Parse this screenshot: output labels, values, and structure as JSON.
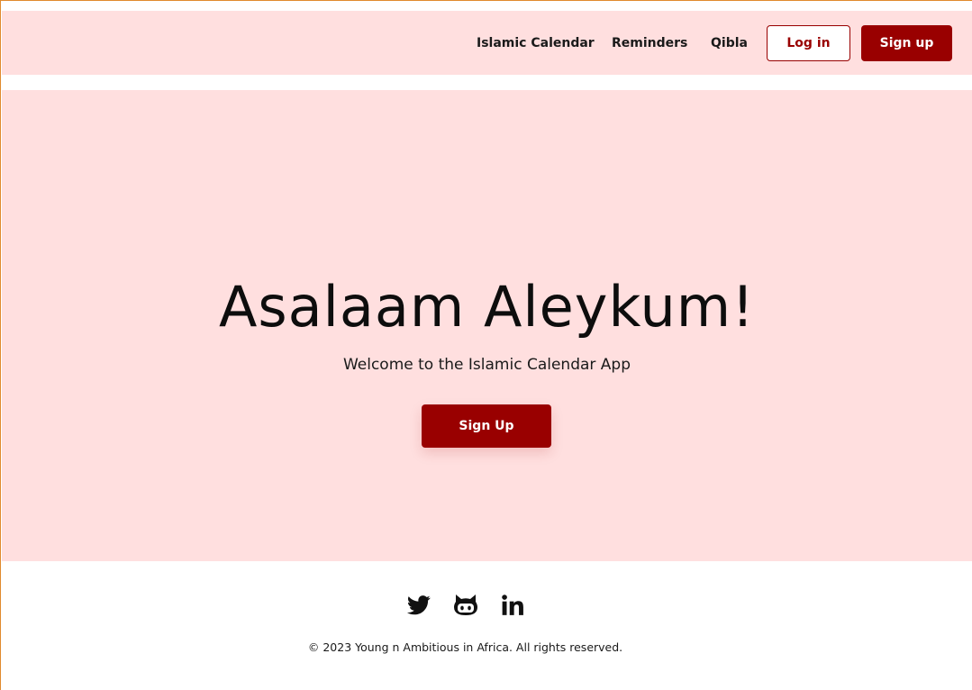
{
  "nav": {
    "links": [
      "Islamic Calendar",
      "Reminders",
      "Qibla"
    ],
    "login_label": "Log in",
    "signup_label": "Sign up"
  },
  "hero": {
    "title": "Asalaam Aleykum!",
    "subtitle": "Welcome to the Islamic Calendar App",
    "cta_label": "Sign Up"
  },
  "footer": {
    "social_icons": [
      "twitter-icon",
      "github-icon",
      "linkedin-icon"
    ],
    "copyright": "© 2023 Young n Ambitious in Africa. All rights reserved."
  },
  "colors": {
    "accent": "#990000",
    "background_tint": "#ffdfdf",
    "frame_border": "#e08a2e"
  }
}
